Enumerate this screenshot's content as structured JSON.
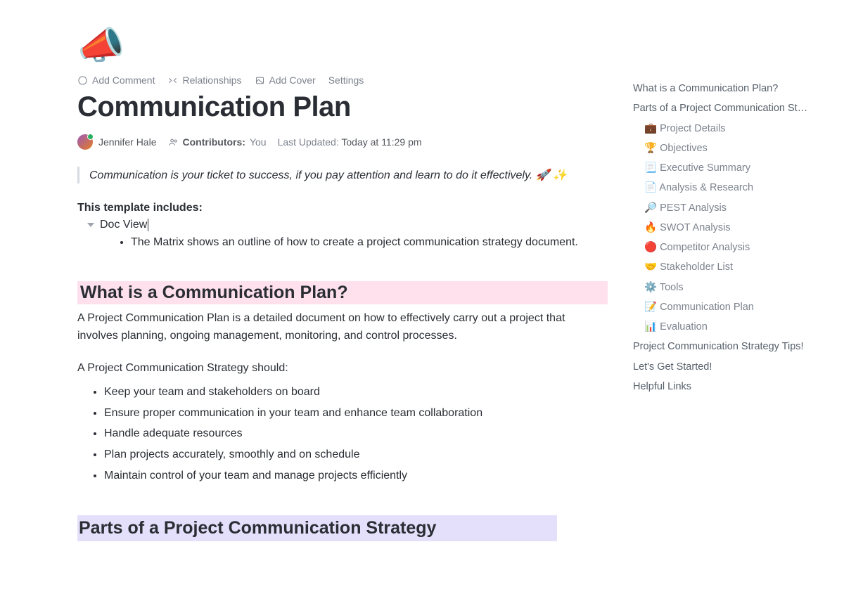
{
  "hero_icon": "📣",
  "toolbar": {
    "add_comment": "Add Comment",
    "relationships": "Relationships",
    "add_cover": "Add Cover",
    "settings": "Settings"
  },
  "title": "Communication Plan",
  "meta": {
    "owner": "Jennifer Hale",
    "contributors_label": "Contributors:",
    "contributors_value": "You",
    "updated_label": "Last Updated:",
    "updated_value": "Today at 11:29 pm"
  },
  "quote": "Communication is your ticket to success, if you pay attention and learn to do it effectively. 🚀 ✨",
  "template_heading": "This template includes:",
  "toggle_label": "Doc View",
  "toggle_bullets": [
    "The Matrix shows an outline of how to create a project communication strategy document."
  ],
  "section1": {
    "heading": "What is a Communication Plan?",
    "para": "A Project Communication Plan is a detailed document on how to effectively carry out a project that involves planning, ongoing management, monitoring, and control processes.",
    "should_label": "A Project Communication Strategy should:",
    "bullets": [
      "Keep your team and stakeholders on board",
      "Ensure proper communication in your team and enhance team collaboration",
      "Handle adequate resources",
      "Plan projects accurately, smoothly and on schedule",
      "Maintain control of your team and manage projects efficiently"
    ]
  },
  "section2": {
    "heading": "Parts of a Project Communication Strategy"
  },
  "outline": {
    "lvl1": [
      "What is a Communication Plan?",
      "Parts of a Project Communication St…"
    ],
    "lvl2": [
      "💼 Project Details",
      "🏆 Objectives",
      "📃 Executive Summary",
      "📄 Analysis & Research",
      "🔎 PEST Analysis",
      "🔥 SWOT Analysis",
      "🔴 Competitor Analysis",
      "🤝 Stakeholder List",
      "⚙️ Tools",
      "📝 Communication Plan",
      "📊 Evaluation"
    ],
    "lvl1b": [
      "Project Communication Strategy Tips!",
      "Let's Get Started!",
      "Helpful Links"
    ]
  }
}
